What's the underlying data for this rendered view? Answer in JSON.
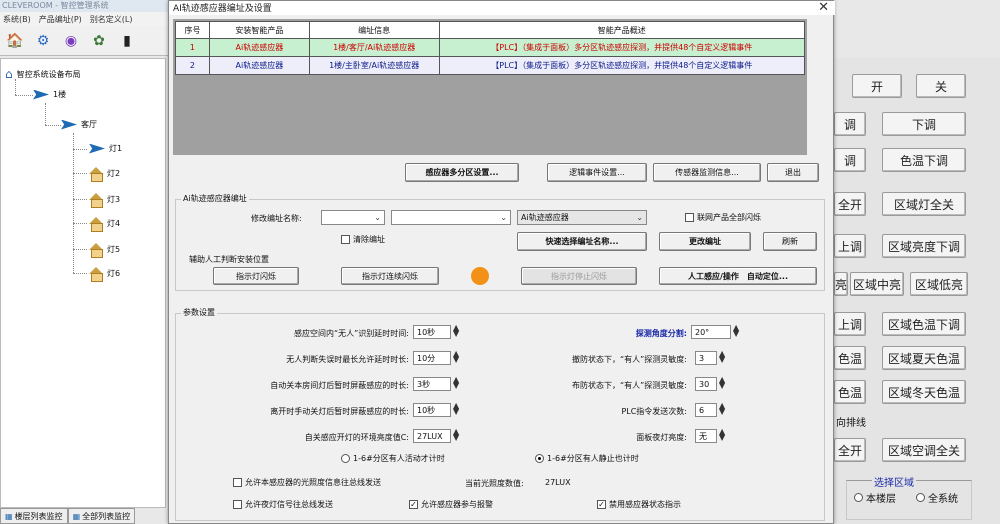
{
  "app": {
    "title": "CLEVEROOM - 智控管理系统",
    "menu": [
      "系统(B)",
      "产品编址(P)",
      "别名定义(L)"
    ],
    "bottom_tabs": [
      "楼层列表监控",
      "全部列表监控"
    ]
  },
  "tree": {
    "root": "智控系统设备布局",
    "building": "1楼",
    "room": "客厅",
    "lights": [
      "灯1",
      "灯2",
      "灯3",
      "灯4",
      "灯5",
      "灯6"
    ]
  },
  "right_buttons": {
    "on": "开",
    "off": "关",
    "down": "下调",
    "up_partial": "调",
    "color_down": "色温下调",
    "tone_partial": "调",
    "zone_all_on": "区域灯全关",
    "all_on_partial": "全开",
    "zone_bright_down": "区域亮度下调",
    "up_adjust_partial": "上调",
    "zone_mid": "区域中亮",
    "zone_low": "区域低亮",
    "mid_partial": "亮",
    "zone_color_down": "区域色温下调",
    "up2_partial": "上调",
    "zone_summer": "区域夏天色温",
    "color1_partial": "色温",
    "zone_winter": "区域冬天色温",
    "color2_partial": "色温",
    "linkage": "向排线",
    "zone_ac_all_off": "区域空调全关",
    "all_on2_partial": "全开",
    "select_zone": "选择区域",
    "this_floor": "本楼层",
    "all_system": "全系统"
  },
  "dialog": {
    "title": "AI轨迹感应器编址及设置",
    "table": {
      "headers": [
        "序号",
        "安装智能产品",
        "编址信息",
        "智能产品概述"
      ],
      "rows": [
        [
          "1",
          "Ai轨迹感应器",
          "1楼/客厅/Ai轨迹感应器",
          "【PLC】（集成于面板）多分区轨迹感应探测，并提供48个自定义逻辑事件"
        ],
        [
          "2",
          "Ai轨迹感应器",
          "1楼/主卧室/Ai轨迹感应器",
          "【PLC】（集成于面板）多分区轨迹感应探测，并提供48个自定义逻辑事件"
        ]
      ]
    },
    "top_buttons": [
      "感应器多分区设置...",
      "逻辑事件设置...",
      "传感器监测信息...",
      "退出"
    ],
    "address_group": {
      "title": "Ai轨迹感应器编址",
      "modify_label": "修改编址名称:",
      "combo3_value": "Ai轨迹感应器",
      "linked_flash": "联网产品全部闪烁",
      "clear_address": "清除编址",
      "quick_select": "快速选择编址名称...",
      "change_address": "更改编址",
      "refresh": "刷新",
      "assist_title": "辅助人工判断安装位置",
      "flash": "指示灯闪烁",
      "flash_cont": "指示灯连续闪烁",
      "stop_flash": "指示灯停止闪烁",
      "manual_sense": "人工感应/操作　自动定位..."
    },
    "params": {
      "title": "参数设置",
      "left": [
        {
          "label": "感应空间内“无人”识别延时时间:",
          "value": "10秒"
        },
        {
          "label": "无人判断失误时最长允许延时时长:",
          "value": "10分"
        },
        {
          "label": "自动关本房间灯后暂时屏蔽感应的时长:",
          "value": "3秒"
        },
        {
          "label": "离开时手动关灯后暂时屏蔽感应的时长:",
          "value": "10秒"
        },
        {
          "label": "自关感应开灯的环境亮度值C:",
          "value": "27LUX"
        }
      ],
      "right": [
        {
          "label": "探测角度分割:",
          "value": "20°"
        },
        {
          "label": "撤防状态下，“有人”探测灵敏度:",
          "value": "3"
        },
        {
          "label": "布防状态下，“有人”探测灵敏度:",
          "value": "30"
        },
        {
          "label": "PLC指令发送次数:",
          "value": "6"
        },
        {
          "label": "面板夜灯亮度:",
          "value": "无"
        }
      ],
      "radio1": "1-6#分区有人活动才计时",
      "radio2": "1-6#分区有人静止也计时",
      "chk1": "允许本感应器的光照度信息往总线发送",
      "current_lux_label": "当前光照度数值:",
      "current_lux": "27LUX",
      "chk2": "允许夜灯信号往总线发送",
      "chk3": "允许感应器参与报警",
      "chk4": "禁用感应器状态指示"
    }
  },
  "colors": {
    "accent_orange": "#f39016",
    "row1": "#c7f0d0",
    "row2": "#eeeefa",
    "blue_label": "#1b2aa8"
  }
}
